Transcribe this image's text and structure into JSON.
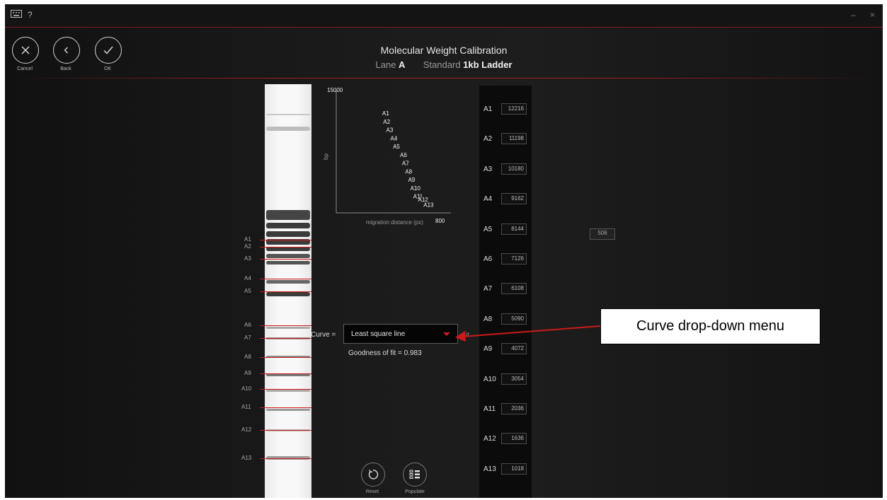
{
  "titlebar": {
    "keyboard_icon": "keyboard-icon",
    "help_label": "?",
    "minimize_label": "–",
    "close_label": "×"
  },
  "nav": {
    "cancel": {
      "icon": "close-icon",
      "label": "Cancel"
    },
    "back": {
      "icon": "chevron-left-icon",
      "label": "Back"
    },
    "ok": {
      "icon": "check-icon",
      "label": "OK"
    }
  },
  "header": {
    "title": "Molecular Weight Calibration",
    "lane_label": "Lane",
    "lane_value": "A",
    "standard_label": "Standard",
    "standard_value": "1kb Ladder"
  },
  "lanes": [
    "A1",
    "A2",
    "A3",
    "A4",
    "A5",
    "A6",
    "A7",
    "A8",
    "A9",
    "A10",
    "A11",
    "A12",
    "A13"
  ],
  "chart_data": {
    "type": "scatter",
    "xlabel": "migration distance (px)",
    "ylabel": "bp",
    "ymax_label": "15000",
    "xmax_label": "800",
    "xlim": [
      0,
      800
    ],
    "ylim": [
      0,
      15000
    ],
    "points": [
      {
        "label": "A1",
        "x": 350,
        "y": 12216
      },
      {
        "label": "A2",
        "x": 357,
        "y": 11198
      },
      {
        "label": "A3",
        "x": 378,
        "y": 10180
      },
      {
        "label": "A4",
        "x": 407,
        "y": 9162
      },
      {
        "label": "A5",
        "x": 425,
        "y": 8144
      },
      {
        "label": "A6",
        "x": 474,
        "y": 7126
      },
      {
        "label": "A7",
        "x": 488,
        "y": 6108
      },
      {
        "label": "A8",
        "x": 510,
        "y": 5090
      },
      {
        "label": "A9",
        "x": 531,
        "y": 4072
      },
      {
        "label": "A10",
        "x": 546,
        "y": 3054
      },
      {
        "label": "A11",
        "x": 566,
        "y": 2036
      },
      {
        "label": "A12",
        "x": 600,
        "y": 1636
      },
      {
        "label": "A13",
        "x": 638,
        "y": 1018
      }
    ]
  },
  "standards": [
    {
      "label": "A1",
      "value": "12216"
    },
    {
      "label": "A2",
      "value": "11198"
    },
    {
      "label": "A3",
      "value": "10180"
    },
    {
      "label": "A4",
      "value": "9162"
    },
    {
      "label": "A5",
      "value": "8144"
    },
    {
      "label": "A6",
      "value": "7126"
    },
    {
      "label": "A7",
      "value": "6108"
    },
    {
      "label": "A8",
      "value": "5090"
    },
    {
      "label": "A9",
      "value": "4072"
    },
    {
      "label": "A10",
      "value": "3054"
    },
    {
      "label": "A11",
      "value": "2036"
    },
    {
      "label": "A12",
      "value": "1636"
    },
    {
      "label": "A13",
      "value": "1018"
    }
  ],
  "side_value": "506",
  "curve": {
    "label": "Curve =",
    "selected": "Least square line",
    "fit_tag": "Fit",
    "goodness": "Goodness of fit = 0.983"
  },
  "actions": {
    "reset": {
      "icon": "reset-icon",
      "label": "Reset"
    },
    "populate": {
      "icon": "populate-icon",
      "label": "Populate"
    }
  },
  "callout": {
    "text": "Curve drop-down menu",
    "color": "#cc1a1a"
  }
}
